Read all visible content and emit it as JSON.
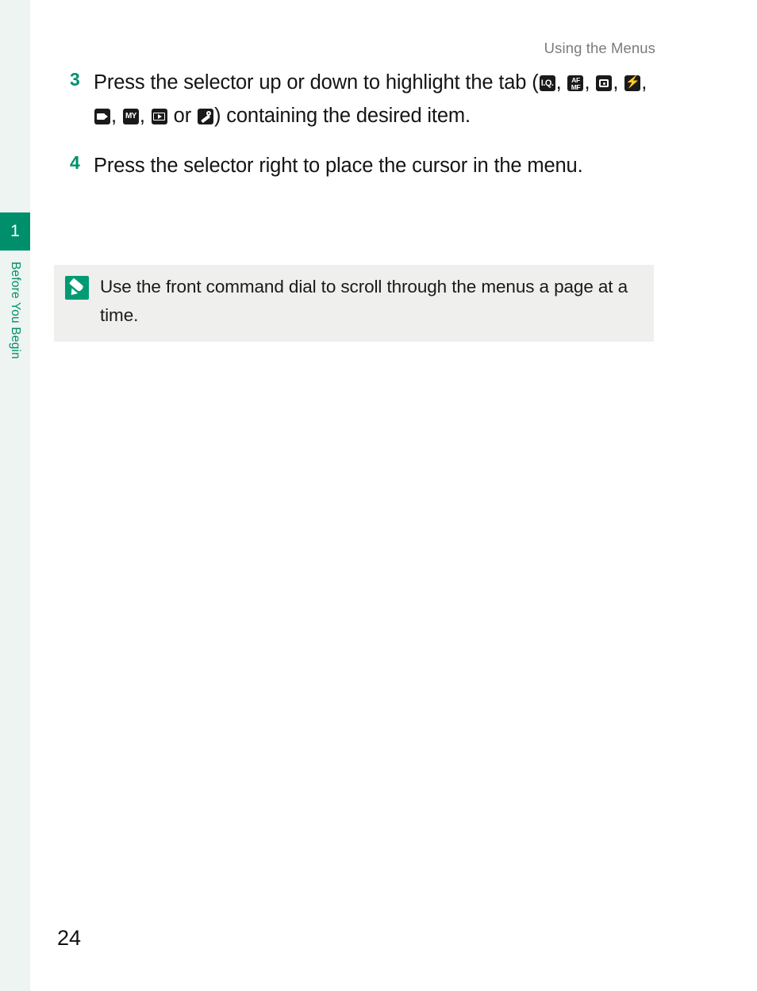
{
  "page": {
    "running_head": "Using the Menus",
    "folio": "24",
    "chapter_number": "1",
    "chapter_title": "Before You Begin",
    "accent_color": "#008f6b",
    "note_icon_color": "#009b74",
    "note_background": "#efefee"
  },
  "steps": [
    {
      "number": "3",
      "text_before_icons": "Press the selector up or down to highlight the tab (",
      "icons": [
        {
          "name": "image-quality-icon",
          "label": "I.Q."
        },
        {
          "name": "af-mf-icon",
          "label": "AF/MF"
        },
        {
          "name": "shooting-setting-icon",
          "label": "Shooting Setting"
        },
        {
          "name": "flash-setting-icon",
          "label": "Flash Setting"
        },
        {
          "name": "movie-setting-icon",
          "label": "Movie Setting"
        },
        {
          "name": "my-menu-icon",
          "label": "MY"
        },
        {
          "name": "playback-menu-icon",
          "label": "Playback"
        },
        {
          "name": "set-up-menu-icon",
          "label": "Set Up"
        }
      ],
      "icon_separator": ", ",
      "icon_conjunction": " or ",
      "text_after_icons": ") containing the desired item."
    },
    {
      "number": "4",
      "text": "Press the selector right to place the cursor in the menu."
    }
  ],
  "note": {
    "icon_name": "tip-pencil-icon",
    "text": "Use the front command dial to scroll through the menus a page at a time."
  }
}
